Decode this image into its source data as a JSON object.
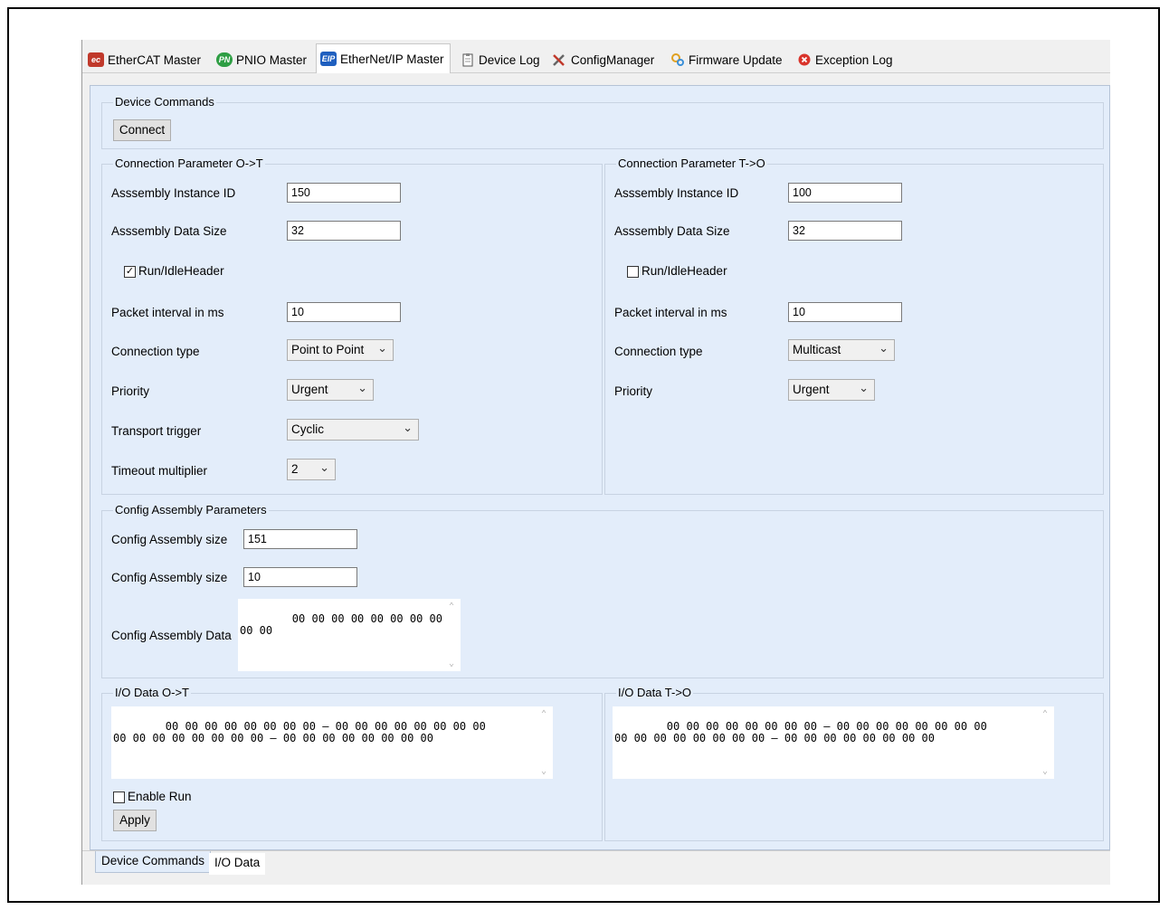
{
  "tabs": [
    {
      "icon": "ec-icon",
      "label": "EtherCAT Master"
    },
    {
      "icon": "pn-icon",
      "label": "PNIO Master"
    },
    {
      "icon": "eip-icon",
      "label": "EtherNet/IP Master"
    },
    {
      "icon": "clipboard-icon",
      "label": "Device Log"
    },
    {
      "icon": "tools-icon",
      "label": "ConfigManager"
    },
    {
      "icon": "firmware-icon",
      "label": "Firmware Update"
    },
    {
      "icon": "error-icon",
      "label": "Exception Log"
    }
  ],
  "device_commands": {
    "title": "Device Commands",
    "connect_label": "Connect"
  },
  "ot": {
    "title": "Connection Parameter O->T",
    "instance_label": "Asssembly Instance ID",
    "instance_value": "150",
    "size_label": "Asssembly Data Size",
    "size_value": "32",
    "runidle_label": "Run/IdleHeader",
    "runidle_checked": "✓",
    "interval_label": "Packet interval in ms",
    "interval_value": "10",
    "conn_type_label": "Connection type",
    "conn_type_value": "Point to Point",
    "priority_label": "Priority",
    "priority_value": "Urgent",
    "trigger_label": "Transport trigger",
    "trigger_value": "Cyclic",
    "timeout_label": "Timeout multiplier",
    "timeout_value": "2"
  },
  "to": {
    "title": "Connection Parameter T->O",
    "instance_label": "Asssembly Instance ID",
    "instance_value": "100",
    "size_label": "Asssembly Data Size",
    "size_value": "32",
    "runidle_label": "Run/IdleHeader",
    "runidle_checked": "",
    "interval_label": "Packet interval in ms",
    "interval_value": "10",
    "conn_type_label": "Connection type",
    "conn_type_value": "Multicast",
    "priority_label": "Priority",
    "priority_value": "Urgent"
  },
  "config": {
    "title": "Config Assembly Parameters",
    "size1_label": "Config Assembly size",
    "size1_value": "151",
    "size2_label": "Config Assembly size",
    "size2_value": "10",
    "data_label": "Config Assembly Data",
    "data_value": "00 00 00 00 00 00 00 00\n00 00"
  },
  "io_ot": {
    "title": "I/O Data O->T",
    "data": "00 00 00 00 00 00 00 00 – 00 00 00 00 00 00 00 00\n00 00 00 00 00 00 00 00 – 00 00 00 00 00 00 00 00",
    "enable_run_label": "Enable Run",
    "apply_label": "Apply"
  },
  "io_to": {
    "title": "I/O Data T->O",
    "data": "00 00 00 00 00 00 00 00 – 00 00 00 00 00 00 00 00\n00 00 00 00 00 00 00 00 – 00 00 00 00 00 00 00 00"
  },
  "bottom_tabs": [
    "Device Commands",
    "I/O Data"
  ]
}
